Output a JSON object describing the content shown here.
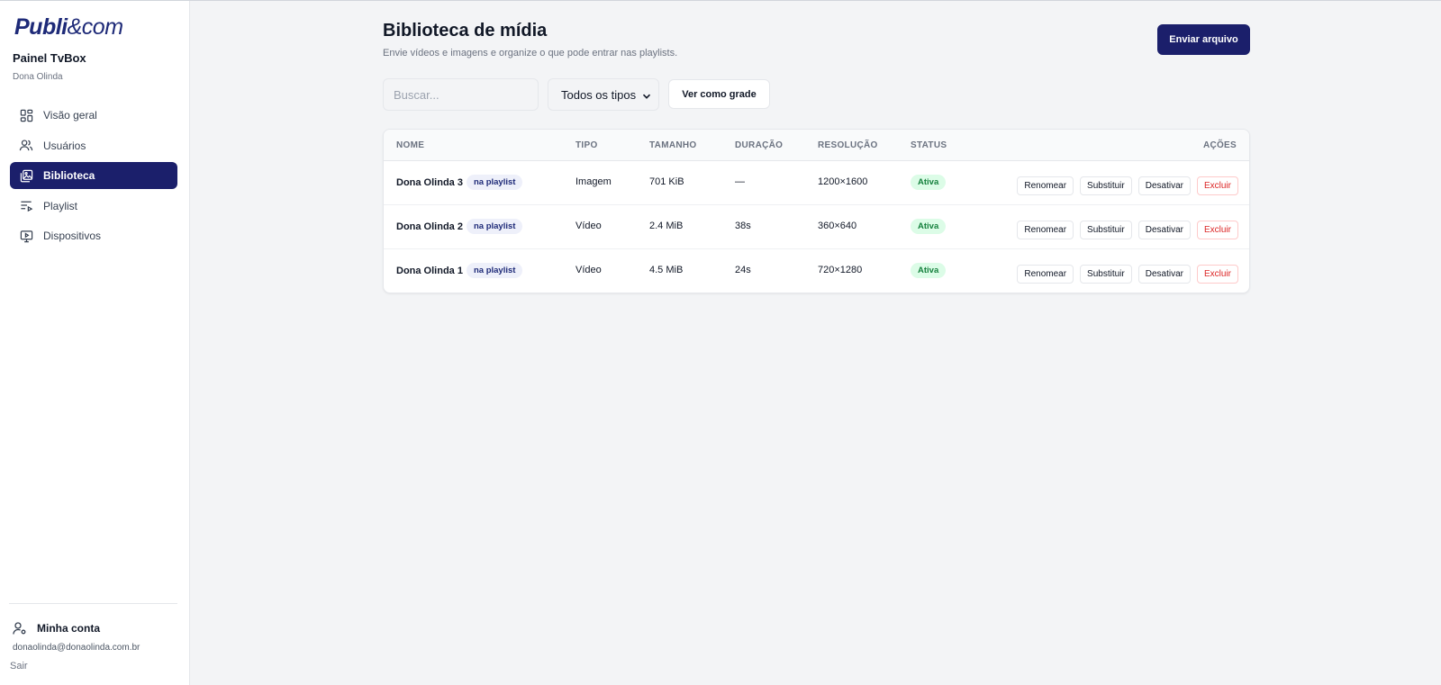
{
  "brand": {
    "logo_bold": "Publi",
    "logo_thin": "&com"
  },
  "sidebar": {
    "panel_title": "Painel TvBox",
    "panel_subtitle": "Dona Olinda",
    "items": [
      {
        "label": "Visão geral",
        "icon": "dashboard-grid-icon",
        "active": false
      },
      {
        "label": "Usuários",
        "icon": "users-icon",
        "active": false
      },
      {
        "label": "Biblioteca",
        "icon": "media-library-icon",
        "active": true
      },
      {
        "label": "Playlist",
        "icon": "playlist-icon",
        "active": false
      },
      {
        "label": "Dispositivos",
        "icon": "monitor-play-icon",
        "active": false
      }
    ],
    "account_label": "Minha conta",
    "account_email": "donaolinda@donaolinda.com.br",
    "logout_label": "Sair"
  },
  "header": {
    "title": "Biblioteca de mídia",
    "subtitle": "Envie vídeos e imagens e organize o que pode entrar nas playlists.",
    "upload_label": "Enviar arquivo"
  },
  "toolbar": {
    "search_placeholder": "Buscar...",
    "type_filter_value": "Todos os tipos",
    "view_toggle_label": "Ver como grade"
  },
  "table": {
    "columns": [
      "NOME",
      "TIPO",
      "TAMANHO",
      "DURAÇÃO",
      "RESOLUÇÃO",
      "STATUS",
      "AÇÕES"
    ],
    "rows": [
      {
        "name": "Dona Olinda 3",
        "tag": "na playlist",
        "type": "Imagem",
        "size": "701 KiB",
        "duration": "—",
        "resolution": "1200×1600",
        "status": "Ativa"
      },
      {
        "name": "Dona Olinda 2",
        "tag": "na playlist",
        "type": "Vídeo",
        "size": "2.4 MiB",
        "duration": "38s",
        "resolution": "360×640",
        "status": "Ativa"
      },
      {
        "name": "Dona Olinda 1",
        "tag": "na playlist",
        "type": "Vídeo",
        "size": "4.5 MiB",
        "duration": "24s",
        "resolution": "720×1280",
        "status": "Ativa"
      }
    ],
    "actions": {
      "rename": "Renomear",
      "replace": "Substituir",
      "deactivate": "Desativar",
      "delete": "Excluir"
    }
  },
  "colors": {
    "primary": "#1b1f6b",
    "success_bg": "#dcfce7",
    "success_text": "#15803d",
    "danger": "#dc2626"
  }
}
